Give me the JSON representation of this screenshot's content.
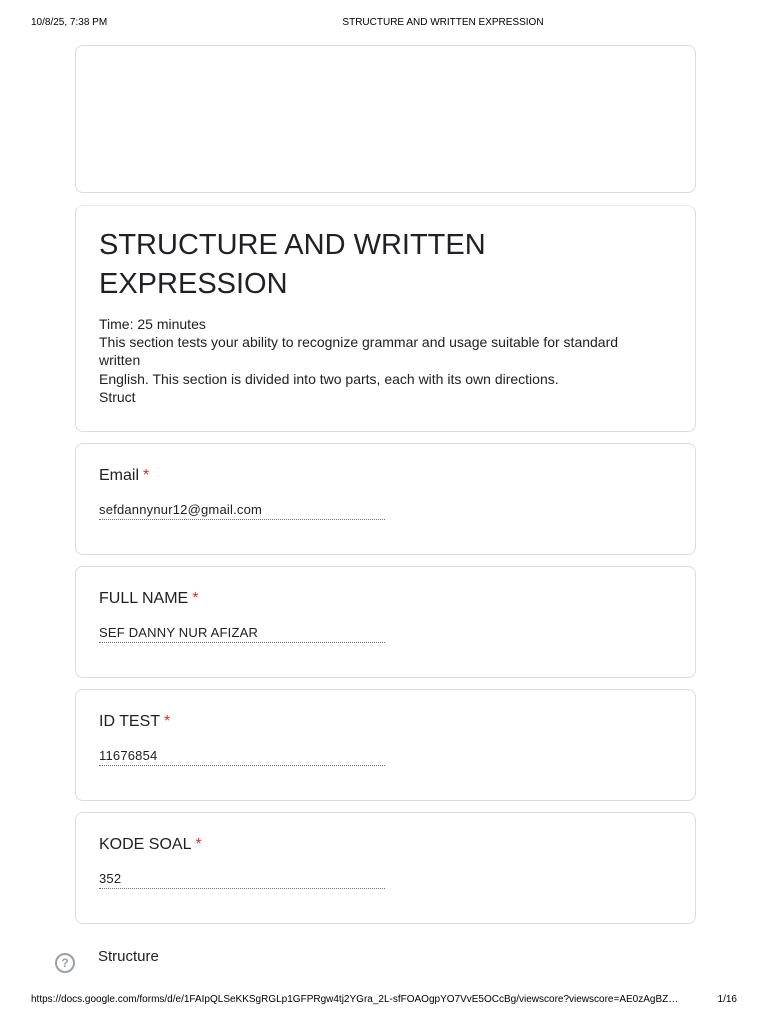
{
  "print_header": {
    "datetime": "10/8/25, 7:38 PM",
    "title": "STRUCTURE AND WRITTEN EXPRESSION"
  },
  "form": {
    "title": "STRUCTURE AND WRITTEN EXPRESSION",
    "description_lines": [
      "Time: 25 minutes",
      "This section tests your ability to recognize grammar and usage suitable for standard written",
      "English. This section is divided into two parts, each with its own directions.",
      "Struct"
    ]
  },
  "questions": [
    {
      "label": "Email",
      "required_mark": "*",
      "answer": "sefdannynur12@gmail.com"
    },
    {
      "label": "FULL NAME",
      "required_mark": "*",
      "answer": "SEF DANNY NUR AFIZAR"
    },
    {
      "label": "ID TEST",
      "required_mark": "*",
      "answer": "11676854"
    },
    {
      "label": "KODE SOAL",
      "required_mark": "*",
      "answer": "352"
    }
  ],
  "section": {
    "help_icon": "help-circle-icon",
    "help_glyph": "?",
    "title": "Structure"
  },
  "print_footer": {
    "url": "https://docs.google.com/forms/d/e/1FAIpQLSeKKSgRGLp1GFPRgw4tj2YGra_2L-sfFOAOgpYO7VvE5OCcBg/viewscore?viewscore=AE0zAgBZ…",
    "page": "1/16"
  },
  "colors": {
    "required": "#d93025",
    "border": "#dadce0",
    "text": "#202124"
  }
}
